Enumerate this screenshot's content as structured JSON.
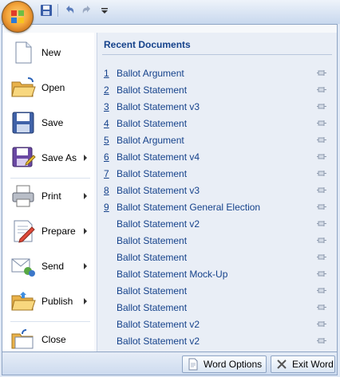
{
  "office_button": {
    "icon": "office-logo-icon"
  },
  "quick_access": {
    "items": [
      {
        "name": "save-icon"
      },
      {
        "name": "undo-icon"
      },
      {
        "name": "redo-icon"
      },
      {
        "name": "customize-toolbar-icon"
      }
    ]
  },
  "left_menu": {
    "items": [
      {
        "label": "New",
        "icon": "new-document-icon",
        "submenu": false
      },
      {
        "label": "Open",
        "icon": "open-folder-icon",
        "submenu": false
      },
      {
        "label": "Save",
        "icon": "save-icon",
        "submenu": false
      },
      {
        "label": "Save As",
        "icon": "save-as-icon",
        "submenu": true
      },
      {
        "label": "Print",
        "icon": "printer-icon",
        "submenu": true
      },
      {
        "label": "Prepare",
        "icon": "prepare-icon",
        "submenu": true
      },
      {
        "label": "Send",
        "icon": "send-icon",
        "submenu": true
      },
      {
        "label": "Publish",
        "icon": "publish-icon",
        "submenu": true
      },
      {
        "label": "Close",
        "icon": "close-folder-icon",
        "submenu": false
      }
    ]
  },
  "recent": {
    "title": "Recent Documents",
    "documents": [
      {
        "num": "1",
        "name": "Ballot Argument"
      },
      {
        "num": "2",
        "name": "Ballot Statement"
      },
      {
        "num": "3",
        "name": "Ballot Statement v3"
      },
      {
        "num": "4",
        "name": "Ballot Statement"
      },
      {
        "num": "5",
        "name": "Ballot Argument"
      },
      {
        "num": "6",
        "name": "Ballot Statement v4"
      },
      {
        "num": "7",
        "name": "Ballot Statement"
      },
      {
        "num": "8",
        "name": "Ballot Statement v3"
      },
      {
        "num": "9",
        "name": "Ballot Statement General Election"
      },
      {
        "num": "",
        "name": "Ballot Statement v2"
      },
      {
        "num": "",
        "name": "Ballot Statement"
      },
      {
        "num": "",
        "name": "Ballot Statement"
      },
      {
        "num": "",
        "name": "Ballot Statement Mock-Up"
      },
      {
        "num": "",
        "name": "Ballot Statement"
      },
      {
        "num": "",
        "name": "Ballot Statement"
      },
      {
        "num": "",
        "name": "Ballot Statement v2"
      },
      {
        "num": "",
        "name": "Ballot Statement v2"
      }
    ]
  },
  "bottom": {
    "options_label": "Word Options",
    "exit_label": "Exit Word"
  },
  "colors": {
    "accent": "#15428b",
    "frame": "#8ea4c4",
    "recent_bg": "#e9eef6"
  }
}
